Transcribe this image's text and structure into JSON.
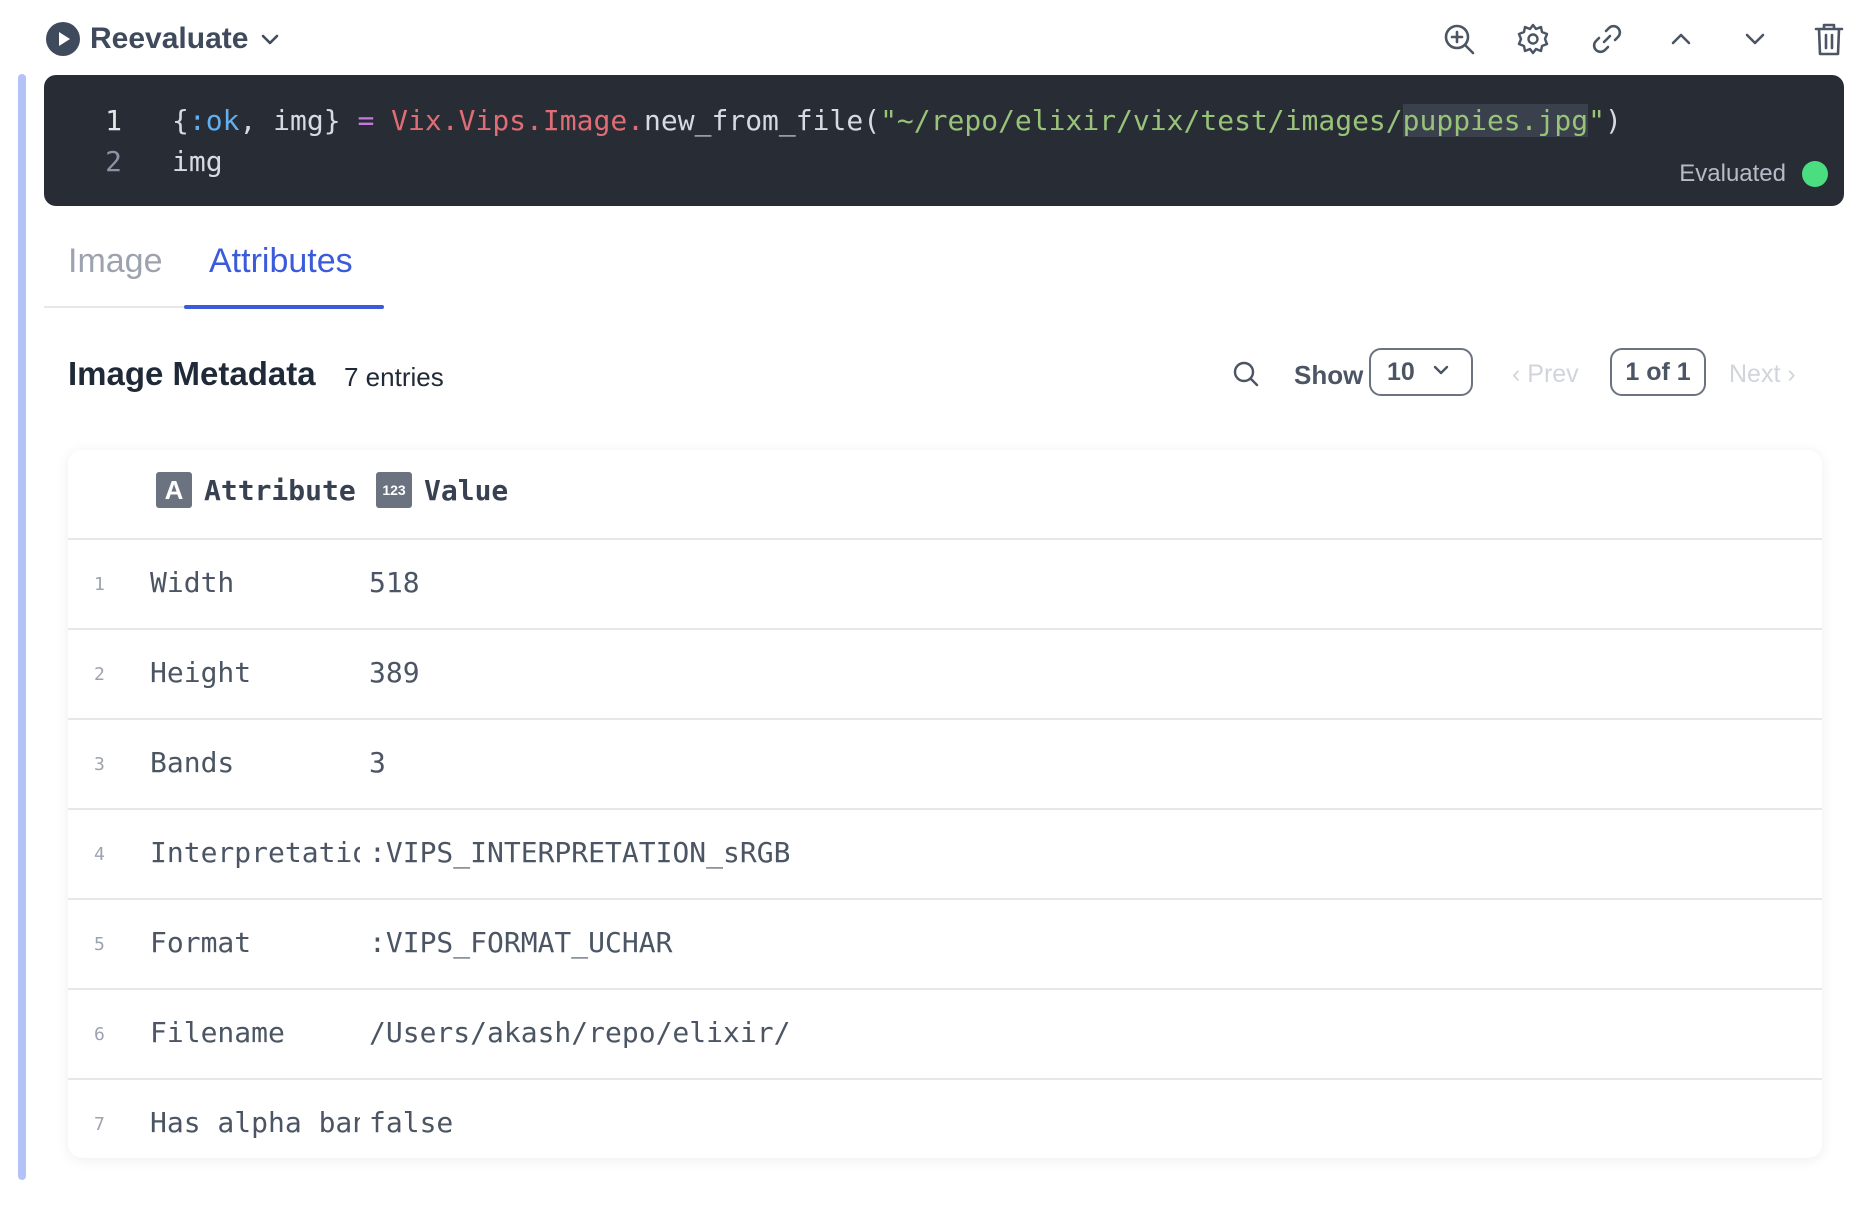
{
  "cell": {
    "reevaluate_label": "Reevaluate",
    "toolbar_icons": [
      "zoom-in-icon",
      "gear-icon",
      "link-icon",
      "chevron-up-icon",
      "chevron-down-icon",
      "trash-icon"
    ]
  },
  "editor": {
    "lines": [
      {
        "number": "1",
        "tokens": [
          {
            "text": "{",
            "kind": "punct"
          },
          {
            "text": ":ok",
            "kind": "atom"
          },
          {
            "text": ", img} ",
            "kind": "punct"
          },
          {
            "text": "=",
            "kind": "op"
          },
          {
            "text": " ",
            "kind": "punct"
          },
          {
            "text": "Vix.Vips.Image.",
            "kind": "mod"
          },
          {
            "text": "new_from_file(",
            "kind": "fn"
          },
          {
            "text": "\"~/repo/elixir/vix/test/images/",
            "kind": "str"
          },
          {
            "text": "puppies.jpg",
            "kind": "sel"
          },
          {
            "text": "\"",
            "kind": "str"
          },
          {
            "text": ")",
            "kind": "fn"
          }
        ]
      },
      {
        "number": "2",
        "tokens": [
          {
            "text": "img",
            "kind": "fn"
          }
        ]
      }
    ],
    "status_label": "Evaluated",
    "status_color": "#4ade80"
  },
  "tabs": [
    {
      "label": "Image",
      "active": false
    },
    {
      "label": "Attributes",
      "active": true
    }
  ],
  "metadata": {
    "title": "Image Metadata",
    "entries_label": "7 entries",
    "show_label": "Show",
    "page_size": "10",
    "prev_label": "Prev",
    "page_indicator": "1 of 1",
    "next_label": "Next"
  },
  "table": {
    "columns": [
      {
        "label": "Attribute",
        "type_badge": "A"
      },
      {
        "label": "Value",
        "type_badge": "123"
      }
    ],
    "rows": [
      {
        "n": "1",
        "attribute": "Width",
        "value": "518"
      },
      {
        "n": "2",
        "attribute": "Height",
        "value": "389"
      },
      {
        "n": "3",
        "attribute": "Bands",
        "value": "3"
      },
      {
        "n": "4",
        "attribute": "Interpretation",
        "value": ":VIPS_INTERPRETATION_sRGB"
      },
      {
        "n": "5",
        "attribute": "Format",
        "value": ":VIPS_FORMAT_UCHAR"
      },
      {
        "n": "6",
        "attribute": "Filename",
        "value": "/Users/akash/repo/elixir/vix/test/images/puppies.jpg"
      },
      {
        "n": "7",
        "attribute": "Has alpha band",
        "value": "false"
      }
    ]
  }
}
